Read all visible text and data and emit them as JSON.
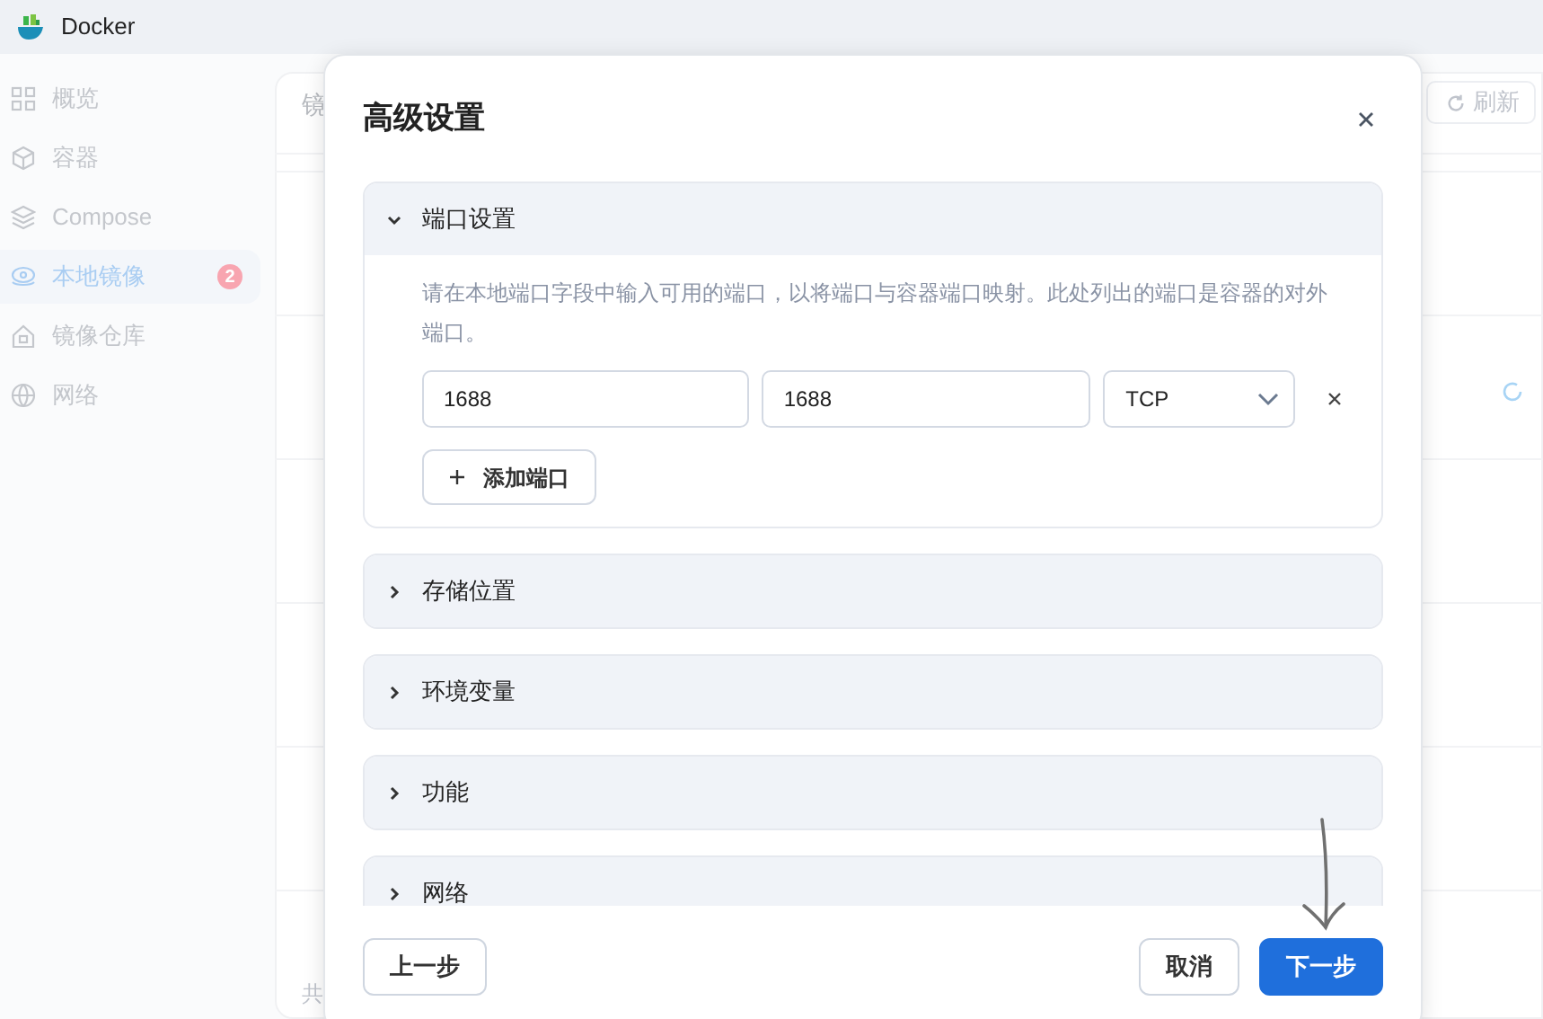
{
  "app": {
    "title": "Docker"
  },
  "sidebar": {
    "items": [
      {
        "label": "概览",
        "selected": false
      },
      {
        "label": "容器",
        "selected": false
      },
      {
        "label": "Compose",
        "selected": false
      },
      {
        "label": "本地镜像",
        "selected": true,
        "badge": "2"
      },
      {
        "label": "镜像仓库",
        "selected": false
      },
      {
        "label": "网络",
        "selected": false
      }
    ]
  },
  "background": {
    "heading_fragment": "镜",
    "refresh_button": "刷新",
    "footer_fragment": "共"
  },
  "dialog": {
    "title": "高级设置",
    "sections": [
      {
        "title": "端口设置",
        "expanded": true,
        "description": "请在本地端口字段中输入可用的端口，以将端口与容器端口映射。此处列出的端口是容器的对外端口。",
        "ports": [
          {
            "host": "1688",
            "container": "1688",
            "protocol": "TCP"
          }
        ],
        "add_button": "添加端口"
      },
      {
        "title": "存储位置",
        "expanded": false
      },
      {
        "title": "环境变量",
        "expanded": false
      },
      {
        "title": "功能",
        "expanded": false
      },
      {
        "title": "网络",
        "expanded": false
      }
    ],
    "buttons": [
      {
        "label": "上一步",
        "kind": "secondary"
      },
      {
        "label": "取消",
        "kind": "secondary"
      },
      {
        "label": "下一步",
        "kind": "primary"
      }
    ]
  }
}
